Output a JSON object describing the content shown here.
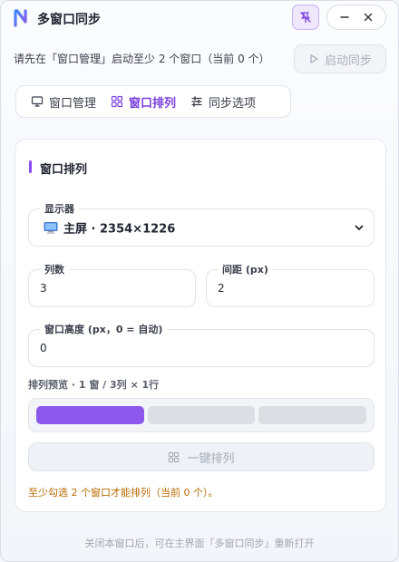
{
  "app": {
    "title": "多窗口同步"
  },
  "window_controls": {
    "minimize": "–",
    "close": "×"
  },
  "hint": {
    "text": "请先在「窗口管理」启动至少 2 个窗口（当前 0 个）"
  },
  "start_button": {
    "label": "启动同步"
  },
  "tabs": [
    {
      "label": "窗口管理",
      "icon": "monitor-icon"
    },
    {
      "label": "窗口排列",
      "icon": "grid-icon",
      "active": true
    },
    {
      "label": "同步选项",
      "icon": "sliders-icon"
    }
  ],
  "panel": {
    "title": "窗口排列",
    "display": {
      "label": "显示器",
      "value": "主屏 · 2354×1226"
    },
    "columns": {
      "label": "列数",
      "value": "3"
    },
    "spacing": {
      "label": "间距 (px)",
      "value": "2"
    },
    "height": {
      "label": "窗口高度 (px，0 = 自动)",
      "value": "0"
    },
    "preview": {
      "label": "排列预览 · 1 窗 / 3列 × 1行",
      "cells": 3,
      "active_cells": 1
    },
    "arrange_button": {
      "label": "一键排列"
    },
    "warning": "至少勾选 2 个窗口才能排列（当前 0 个）。"
  },
  "footer": "关闭本窗口后，可在主界面「多窗口同步」重新打开",
  "colors": {
    "accent": "#8b57ec",
    "warning": "#b96a00"
  }
}
